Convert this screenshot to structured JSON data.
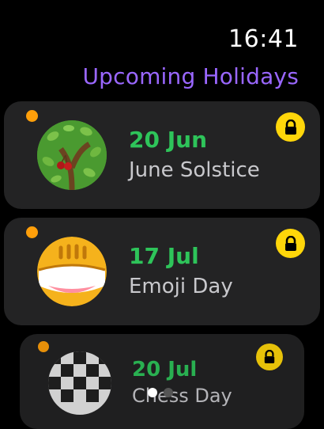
{
  "status": {
    "time": "16:41"
  },
  "header": {
    "title": "Upcoming Holidays"
  },
  "holidays": [
    {
      "date": "20 Jun",
      "name": "June Solstice",
      "icon": "tree-cherry-icon"
    },
    {
      "date": "17 Jul",
      "name": "Emoji Day",
      "icon": "laughing-emoji-icon"
    },
    {
      "date": "20 Jul",
      "name": "Chess Day",
      "icon": "chessboard-icon"
    }
  ],
  "colors": {
    "title": "#9a67ff",
    "date": "#2ec45a",
    "dot": "#ff9f0a",
    "lock": "#ffd60a",
    "card": "#232324"
  },
  "pager": {
    "pages": 2,
    "active": 0
  }
}
